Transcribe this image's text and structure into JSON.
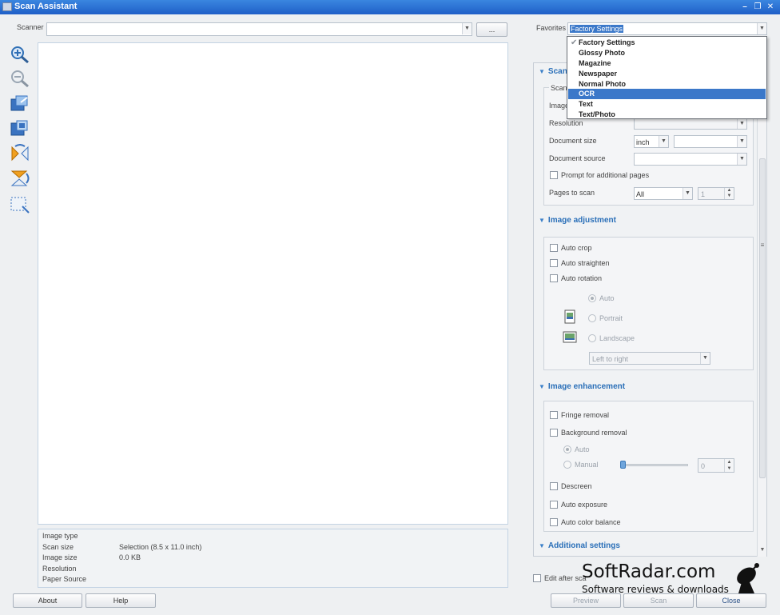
{
  "window": {
    "title": "Scan Assistant",
    "minimize": "–",
    "restore": "❐",
    "close": "✕"
  },
  "scanner": {
    "label": "Scanner",
    "value": "",
    "browse_label": "..."
  },
  "favorites": {
    "label": "Favorites",
    "value": "Factory Settings",
    "options": [
      "Factory Settings",
      "Glossy Photo",
      "Magazine",
      "Newspaper",
      "Normal Photo",
      "OCR",
      "Text",
      "Text/Photo"
    ],
    "checked": "Factory Settings",
    "highlighted": "OCR"
  },
  "toolbar": [
    "zoom-in-icon",
    "zoom-out-icon",
    "fit-page-icon",
    "fit-width-icon",
    "flip-horizontal-icon",
    "flip-vertical-icon",
    "select-area-icon"
  ],
  "info": {
    "rows": [
      {
        "label": "Image type",
        "value": ""
      },
      {
        "label": "Scan size",
        "value": "Selection (8.5 x 11.0 inch)"
      },
      {
        "label": "Image size",
        "value": "0.0 KB"
      },
      {
        "label": "Resolution",
        "value": ""
      },
      {
        "label": "Paper Source",
        "value": ""
      }
    ]
  },
  "scan_section": {
    "title": "Scan",
    "group_title": "Scan",
    "image_label": "Image",
    "resolution_label": "Resolution",
    "document_size_label": "Document size",
    "document_size_unit": "inch",
    "document_source_label": "Document source",
    "prompt_label": "Prompt for additional pages",
    "pages_label": "Pages to scan",
    "pages_value": "All",
    "pages_count": "1"
  },
  "image_adjustment": {
    "title": "Image adjustment",
    "auto_crop": "Auto crop",
    "auto_straighten": "Auto straighten",
    "auto_rotation": "Auto rotation",
    "auto": "Auto",
    "portrait": "Portrait",
    "landscape": "Landscape",
    "direction": "Left to right"
  },
  "image_enhancement": {
    "title": "Image enhancement",
    "fringe_removal": "Fringe removal",
    "background_removal": "Background removal",
    "auto": "Auto",
    "manual": "Manual",
    "manual_value": "0",
    "descreen": "Descreen",
    "auto_exposure": "Auto exposure",
    "auto_color_balance": "Auto color balance"
  },
  "additional_settings": {
    "title": "Additional settings"
  },
  "bottom": {
    "about": "About",
    "help": "Help",
    "edit_after_scan": "Edit after sca",
    "preview": "Preview",
    "scan": "Scan",
    "close": "Close"
  },
  "watermark": {
    "brand": "SoftRadar.com",
    "tagline": "Software reviews & downloads"
  },
  "colors": {
    "titlebar": "#2a6fd6",
    "accent": "#2a6fb8",
    "selection": "#3b78c9"
  }
}
